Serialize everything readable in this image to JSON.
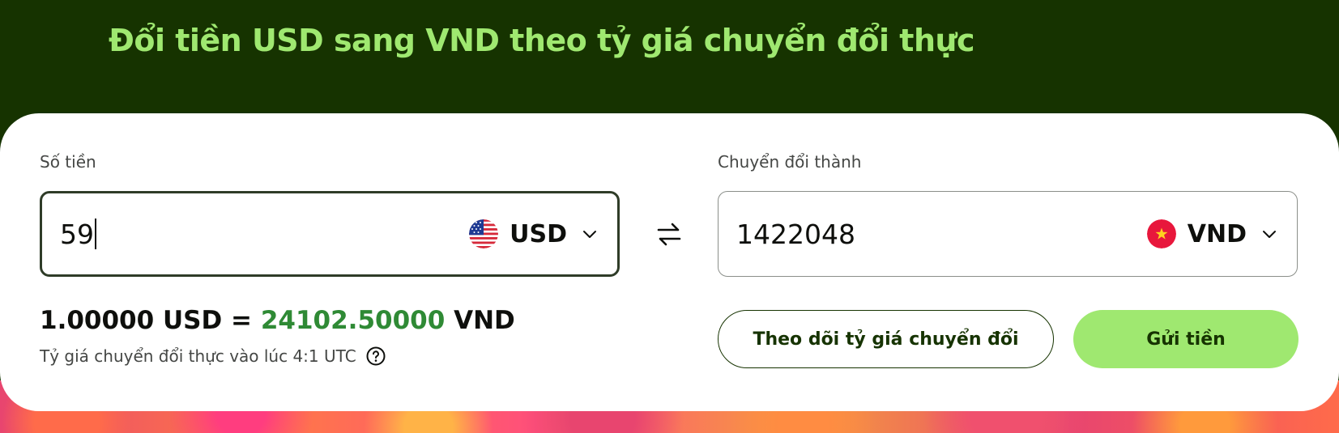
{
  "header": {
    "title": "Đổi tiền USD sang VND theo tỷ giá chuyển đổi thực"
  },
  "converter": {
    "from": {
      "label": "Số tiền",
      "value": "59",
      "currency": "USD",
      "flag_icon": "us-flag-icon"
    },
    "to": {
      "label": "Chuyển đổi thành",
      "value": "1422048",
      "currency": "VND",
      "flag_icon": "vietnam-flag-icon"
    },
    "swap_icon": "swap-arrows-icon",
    "rate": {
      "base_amount": "1.00000 USD",
      "equals": "=",
      "converted_amount": "24102.50000",
      "target_currency": "VND"
    },
    "rate_note": "Tỷ giá chuyển đổi thực vào lúc 4:1 UTC",
    "buttons": {
      "track": "Theo dõi tỷ giá chuyển đổi",
      "send": "Gửi tiền"
    }
  },
  "colors": {
    "background": "#163300",
    "accent": "#9fe870",
    "rate_green": "#2f8a35",
    "text_dark": "#0e0f0c"
  }
}
